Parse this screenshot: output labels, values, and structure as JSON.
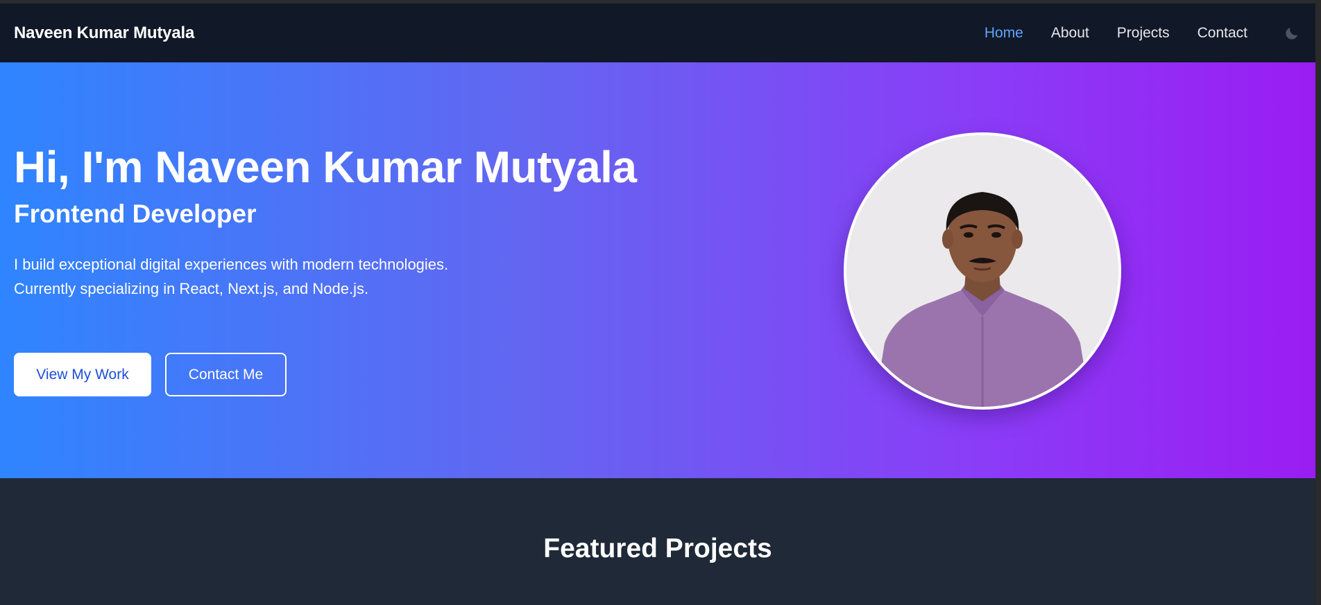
{
  "nav": {
    "brand": "Naveen Kumar Mutyala",
    "links": [
      {
        "label": "Home",
        "active": true
      },
      {
        "label": "About",
        "active": false
      },
      {
        "label": "Projects",
        "active": false
      },
      {
        "label": "Contact",
        "active": false
      }
    ],
    "theme_toggle_icon": "moon-icon"
  },
  "hero": {
    "title": "Hi, I'm Naveen Kumar Mutyala",
    "subtitle": "Frontend Developer",
    "description": "I build exceptional digital experiences with modern technologies. Currently specializing in React, Next.js, and Node.js.",
    "primary_button": "View My Work",
    "secondary_button": "Contact Me"
  },
  "projects": {
    "title": "Featured Projects"
  },
  "colors": {
    "nav_bg": "#111827",
    "active_link": "#60a5fa",
    "gradient_start": "#2f85ff",
    "gradient_end": "#9a1df2",
    "section_bg": "#1f2937"
  }
}
